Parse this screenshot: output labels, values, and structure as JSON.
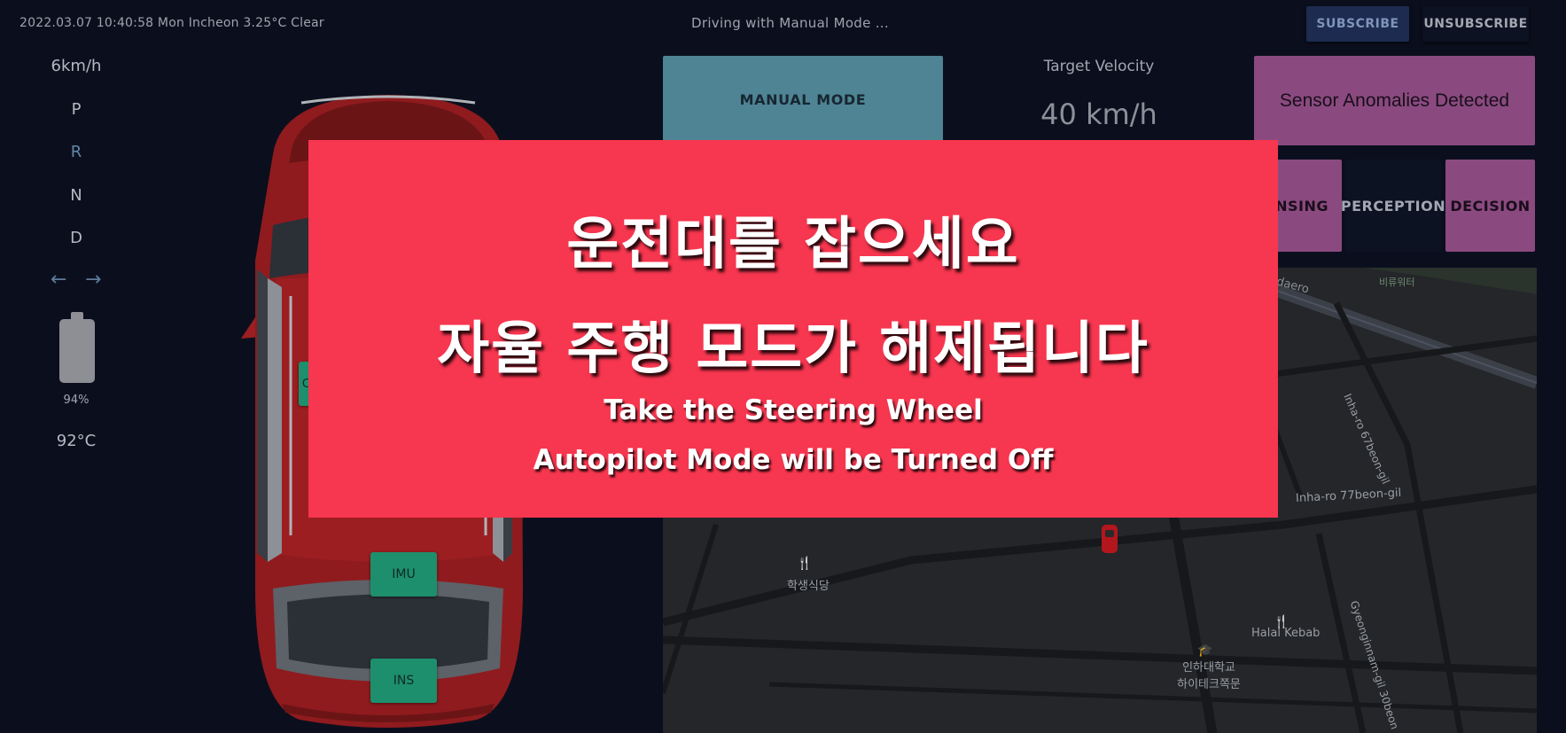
{
  "header": {
    "datetime": "2022.03.07 10:40:58 Mon Incheon 3.25°C Clear",
    "status": "Driving with Manual Mode ...",
    "subscribe_label": "SUBSCRIBE",
    "unsubscribe_label": "UNSUBSCRIBE"
  },
  "gauges": {
    "speed": "6km/h",
    "gears": [
      "P",
      "R",
      "N",
      "D"
    ],
    "active_gear": "R",
    "turn_left_icon": "arrow-left-icon",
    "turn_right_icon": "arrow-right-icon",
    "battery_level": 0.94,
    "battery_percent": "94%",
    "temperature": "92°C"
  },
  "car": {
    "sensors": {
      "camera": "C",
      "imu": "IMU",
      "ins": "INS"
    },
    "color": "#8f1b1e"
  },
  "mode_card": {
    "label": "MANUAL MODE"
  },
  "target_velocity": {
    "label": "Target Velocity",
    "value": "40 km/h"
  },
  "anomaly_card": {
    "label": "Sensor Anomalies Detected"
  },
  "pipeline": {
    "sensing": "SENSING",
    "perception": "PERCEPTION",
    "decision": "DECISION"
  },
  "map": {
    "labels": {
      "road_daero": "daero",
      "park": "비류워터",
      "inha_67": "Inha-ro 67beon-gil",
      "inha_77": "Inha-ro 77beon-gil",
      "cafeteria": "학생식당",
      "halal": "Halal Kebab",
      "university_line1": "인하대학교",
      "university_line2": "하이테크쪽문",
      "gyeongin": "Gyeonginnam-gil 30beon"
    }
  },
  "alert": {
    "ko_line1": "운전대를 잡으세요",
    "ko_line2": "자율 주행 모드가 해제됩니다",
    "en_line1": "Take the Steering Wheel",
    "en_line2": "Autopilot Mode will be Turned Off"
  },
  "colors": {
    "background": "#0b0f1d",
    "alert": "#f7364f",
    "manual_mode": "#4e8494",
    "anomaly": "#8a4a80",
    "sensor_chip": "#1d8f6c",
    "active_gear": "#5f86a8"
  }
}
